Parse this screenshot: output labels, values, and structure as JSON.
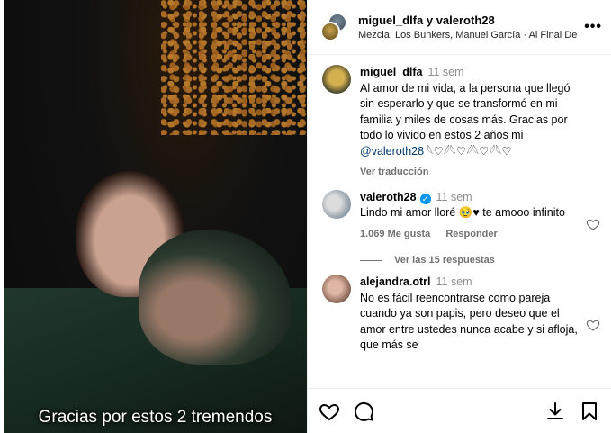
{
  "post": {
    "caption_overlay": "Gracias por estos 2 tremendos"
  },
  "header": {
    "names": "miguel_dlfa y valeroth28",
    "music": "Mezcla: Los Bunkers, Manuel García · Al Final De Este Viaje",
    "more_label": "•••"
  },
  "comments": [
    {
      "user": "miguel_dlfa",
      "time": "11 sem",
      "text_before": "Al amor de mi vida, a la persona que llegó sin esperarlo y que se transformó en mi familia y miles de cosas más. Gracias por todo lo vivido en estos 2 años mi ",
      "mention": "@valeroth28",
      "text_after": " 𓆩♡𓆪𓆩♡𓆪𓆩♡𓆪𓆩♡",
      "sub_action": "Ver traducción"
    },
    {
      "user": "valeroth28",
      "time": "11 sem",
      "text": "Lindo mi amor lloré 🥹♥ te amooo infinito",
      "likes": "1.069 Me gusta",
      "reply": "Responder",
      "view_replies": "Ver las 15 respuestas"
    },
    {
      "user": "alejandra.otrl",
      "time": "11 sem",
      "text": "No es fácil reencontrarse como pareja cuando ya son papis, pero deseo que el amor entre ustedes nunca acabe y si afloja, que más se"
    }
  ],
  "icons": {
    "like": "heart-icon",
    "comment": "comment-icon",
    "download": "download-icon",
    "save": "bookmark-icon"
  }
}
